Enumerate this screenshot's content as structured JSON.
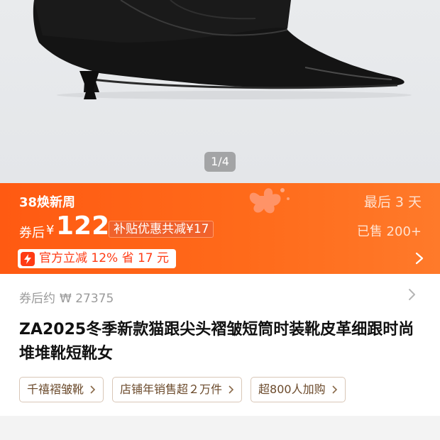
{
  "gallery": {
    "counter": "1/4"
  },
  "promo": {
    "campaign_name": "38焕新周",
    "ends_in": "最后 3 天",
    "price_prefix": "券后",
    "currency": "¥",
    "price": "122",
    "subsidy": "补贴优惠共减¥17",
    "sold": "已售 200+",
    "coupon": "官方立减 12% 省 17 元"
  },
  "info": {
    "after_label": "券后约",
    "after_value": "₩ 27375",
    "title": "ZA2025冬季新款猫跟尖头褶皱短筒时装靴皮革细跟时尚堆堆靴短靴女",
    "tags": [
      "千禧褶皱靴",
      "店铺年销售超２万件",
      "超800人加购"
    ]
  },
  "colors": {
    "promo_orange": "#ff5a12",
    "coupon_text": "#ff3b14",
    "tag_text": "#6b4a2b"
  }
}
